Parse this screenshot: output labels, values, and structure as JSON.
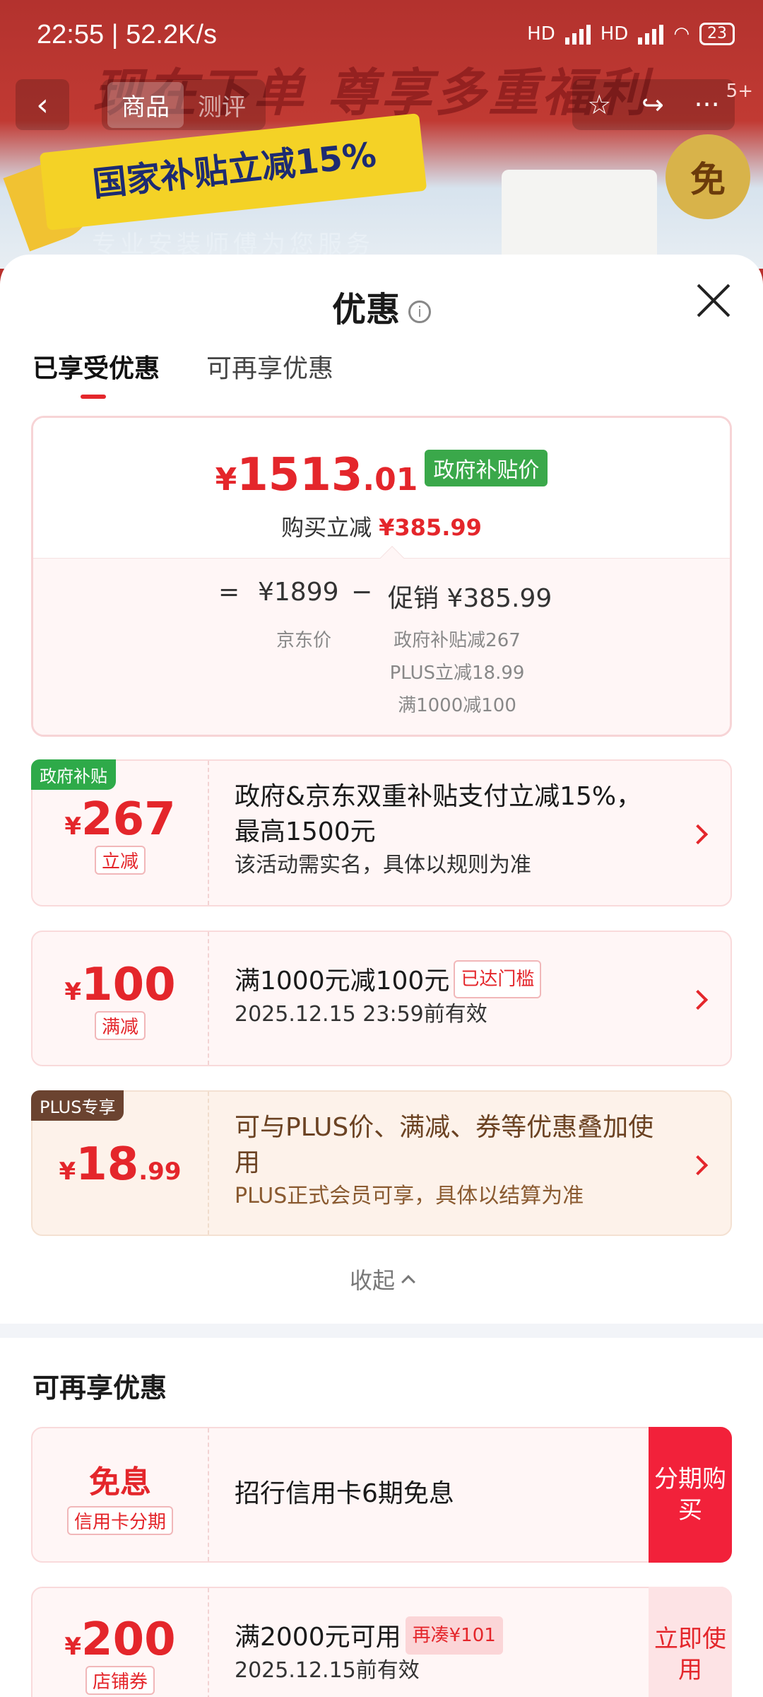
{
  "status_bar": {
    "time": "22:55 | 52.2K/s",
    "signal1": "HD",
    "signal2": "HD",
    "battery": "23"
  },
  "nav": {
    "back_icon": "‹",
    "tabs": [
      "商品",
      "测评"
    ],
    "actions": [
      "☆",
      "↪",
      "···"
    ],
    "count": "5+"
  },
  "banner": {
    "headline": "现在下单 尊享多重福利",
    "ribbon": "国家补贴立减15%",
    "subline": "专业安装师傅为您服务",
    "badge": "免"
  },
  "sheet": {
    "title": "优惠",
    "info_icon": "i"
  },
  "tabs": [
    {
      "label": "已享受优惠"
    },
    {
      "label": "可再享优惠"
    }
  ],
  "summary": {
    "currency": "¥",
    "price_int": "1513",
    "price_dec": ".01",
    "price_tag": "政府补贴价",
    "reduce_label": "购买立减",
    "reduce_amount": "¥385.99",
    "eq": "=",
    "base_price": "¥1899",
    "minus": "−",
    "promo_label": "促销 ¥385.99",
    "base_caption": "京东价",
    "promo_lines": [
      "政府补贴减267",
      "PLUS立减18.99",
      "满1000减100"
    ]
  },
  "applied": [
    {
      "corner": "政府补贴",
      "currency": "¥",
      "amount": "267",
      "decimal": "",
      "tag": "立减",
      "title": "政府&京东双重补贴支付立减15%，最高1500元",
      "desc": "该活动需实名，具体以规则为准"
    },
    {
      "corner": "",
      "currency": "¥",
      "amount": "100",
      "decimal": "",
      "tag": "满减",
      "title": "满1000元减100元",
      "title_badge": "已达门槛",
      "desc": "2025.12.15 23:59前有效"
    },
    {
      "corner": "PLUS专享",
      "currency": "¥",
      "amount": "18",
      "decimal": ".99",
      "tag": "",
      "title": "可与PLUS价、满减、券等优惠叠加使用",
      "desc": "PLUS正式会员可享，具体以结算为准"
    }
  ],
  "collapse_label": "收起",
  "more_title": "可再享优惠",
  "more": [
    {
      "headline": "免息",
      "tag": "信用卡分期",
      "title": "招行信用卡6期免息",
      "cta": "分期购买"
    },
    {
      "currency": "¥",
      "amount": "200",
      "tag": "店铺券",
      "title": "满2000元可用",
      "title_badge": "再凑¥101",
      "desc": "2025.12.15前有效",
      "cta": "立即使用"
    }
  ],
  "colors": {
    "accent": "#e4262b",
    "gov_green": "#3aa84a",
    "plus_brown": "#6b4222"
  }
}
